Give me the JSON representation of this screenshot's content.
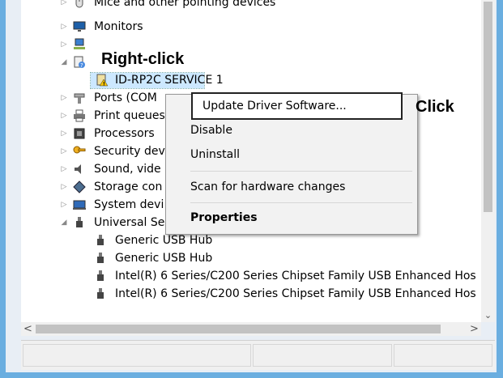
{
  "tree": {
    "rows": [
      {
        "label": "Mice and other pointing devices",
        "expander": "▷",
        "icon": "mouse-icon"
      },
      {
        "label": "Monitors",
        "expander": "▷",
        "icon": "monitor-icon"
      },
      {
        "label": "",
        "expander": "▷",
        "icon": "network-icon"
      },
      {
        "label": "",
        "expander": "◢",
        "icon": "unknown-device-icon"
      },
      {
        "label": "ID-RP2C SERVICE 1",
        "expander": "",
        "icon": "warning-device-icon"
      },
      {
        "label": "Ports (COM",
        "expander": "▷",
        "icon": "port-icon"
      },
      {
        "label": "Print queues",
        "expander": "▷",
        "icon": "printer-icon"
      },
      {
        "label": "Processors",
        "expander": "▷",
        "icon": "processor-icon"
      },
      {
        "label": "Security dev",
        "expander": "▷",
        "icon": "security-icon"
      },
      {
        "label": "Sound, vide",
        "expander": "▷",
        "icon": "sound-icon"
      },
      {
        "label": "Storage con",
        "expander": "▷",
        "icon": "storage-icon"
      },
      {
        "label": "System devi",
        "expander": "▷",
        "icon": "system-icon"
      },
      {
        "label": "Universal Serial Bus controllers",
        "expander": "◢",
        "icon": "usb-icon"
      },
      {
        "label": "Generic USB Hub",
        "expander": "",
        "icon": "usb-device-icon"
      },
      {
        "label": "Generic USB Hub",
        "expander": "",
        "icon": "usb-device-icon"
      },
      {
        "label": "Intel(R) 6 Series/C200 Series Chipset Family USB Enhanced Hos",
        "expander": "",
        "icon": "usb-device-icon"
      },
      {
        "label": "Intel(R) 6 Series/C200 Series Chipset Family USB Enhanced Hos",
        "expander": "",
        "icon": "usb-device-icon"
      }
    ]
  },
  "menu": {
    "update": "Update Driver Software...",
    "disable": "Disable",
    "uninstall": "Uninstall",
    "scan": "Scan for hardware changes",
    "properties": "Properties"
  },
  "callouts": {
    "right_click": "Right-click",
    "click": "Click"
  },
  "scroll": {
    "left": "<",
    "right": ">",
    "down": "⌄"
  }
}
